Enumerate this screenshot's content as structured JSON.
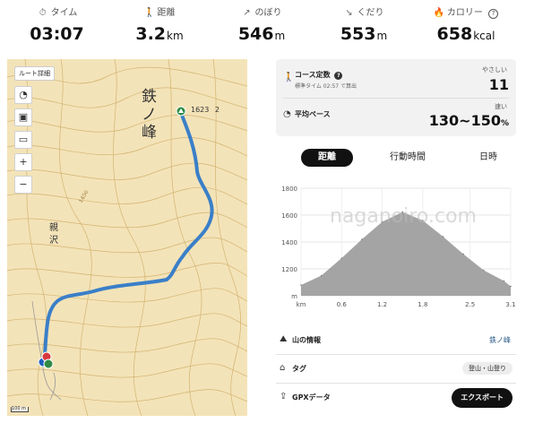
{
  "stats": [
    {
      "icon": "stopwatch-icon",
      "glyph": "⏱",
      "label": "タイム",
      "value": "03:07",
      "unit": ""
    },
    {
      "icon": "walking-icon",
      "glyph": "🚶",
      "label": "距離",
      "value": "3.2",
      "unit": "km"
    },
    {
      "icon": "arrow-up-right-icon",
      "glyph": "↗",
      "label": "のぼり",
      "value": "546",
      "unit": "m"
    },
    {
      "icon": "arrow-down-right-icon",
      "glyph": "↘",
      "label": "くだり",
      "value": "553",
      "unit": "m"
    },
    {
      "icon": "flame-icon",
      "glyph": "🔥",
      "label": "カロリー",
      "value": "658",
      "unit": "kcal",
      "help": "?"
    }
  ],
  "map": {
    "route_button": "ルート詳細",
    "peak_name": "鉄ノ峰",
    "peak_elevation": "1623",
    "peak_suffix": "2",
    "valley_name": "親沢",
    "contour_label": "1450",
    "scale_label": "100 m",
    "route_color": "#3a7fc8",
    "terrain_color": "#f3e3b8",
    "contour_color": "#c9a45a"
  },
  "course": {
    "title": "コース定数",
    "help": "?",
    "sub": "標準タイム 02:57 で算出",
    "difficulty": "やさしい",
    "value": "11"
  },
  "pace": {
    "title": "平均ペース",
    "speed": "速い",
    "value": "130~150",
    "unit": "%"
  },
  "tabs": [
    "距離",
    "行動時間",
    "日時"
  ],
  "active_tab": 0,
  "watermark": "naganoiro.com",
  "chart_data": {
    "type": "area",
    "title": "",
    "xlabel": "km",
    "ylabel": "m",
    "x": [
      0,
      0.3,
      0.6,
      0.9,
      1.2,
      1.5,
      1.8,
      2.1,
      2.4,
      2.7,
      3.0,
      3.1
    ],
    "values": [
      1080,
      1150,
      1280,
      1420,
      1550,
      1623,
      1560,
      1440,
      1310,
      1190,
      1110,
      1070
    ],
    "xlim": [
      0,
      3.1
    ],
    "ylim": [
      1000,
      1800
    ],
    "x_ticks": [
      "km",
      "0.6",
      "1.2",
      "1.8",
      "2.5",
      "3.1"
    ],
    "y_ticks": [
      "1800",
      "1600",
      "1400",
      "1200",
      "m"
    ],
    "fill_color": "#9a9a9a",
    "grid": true
  },
  "rows": {
    "mountain": {
      "label": "山の情報",
      "value": "鉄ノ峰"
    },
    "tag": {
      "label": "タグ",
      "value": "登山・山登り"
    },
    "gpx": {
      "label": "GPXデータ",
      "button": "エクスポート"
    }
  }
}
